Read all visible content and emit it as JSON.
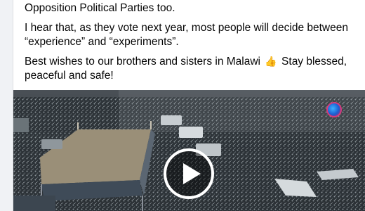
{
  "post": {
    "paragraphs": {
      "p1": "Opposition Political Parties too.",
      "p2": "I hear that, as they vote next year, most people will decide between “experience” and “experiments”.",
      "p3_before": "Best wishes to our brothers and sisters in Malawi",
      "p3_emoji": "👍",
      "p3_after": "Stay blessed, peaceful and safe!"
    }
  },
  "video": {
    "play_icon": "play-icon",
    "logo_icon": "channel-logo-icon",
    "colors": {
      "play_ring": "#ffffff",
      "scene_dark": "#2a3036",
      "stage_roof": "#9a8f78"
    }
  }
}
